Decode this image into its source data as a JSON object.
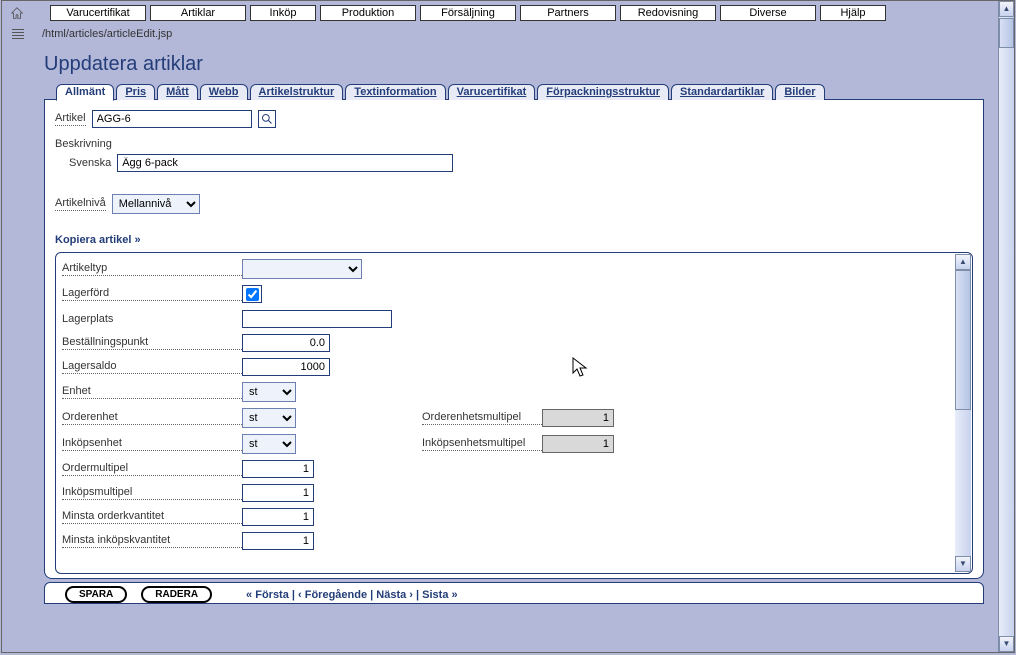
{
  "topmenu": [
    "Varucertifikat",
    "Artiklar",
    "Inköp",
    "Produktion",
    "Försäljning",
    "Partners",
    "Redovisning",
    "Diverse",
    "Hjälp"
  ],
  "path": "/html/articles/articleEdit.jsp",
  "title": "Uppdatera artiklar",
  "tabs": [
    "Allmänt",
    "Pris",
    "Mått",
    "Webb",
    "Artikelstruktur",
    "Textinformation",
    "Varucertifikat",
    "Förpackningsstruktur",
    "Standardartiklar",
    "Bilder"
  ],
  "active_tab": 0,
  "article": {
    "label": "Artikel",
    "value": "AGG-6"
  },
  "description": {
    "heading": "Beskrivning",
    "lang_label": "Svenska",
    "value": "Ägg 6-pack"
  },
  "level": {
    "label": "Artikelnivå",
    "value": "Mellannivå"
  },
  "copy_link": "Kopiera artikel »",
  "form": {
    "artikeltyp": {
      "label": "Artikeltyp",
      "value": ""
    },
    "lagerford": {
      "label": "Lagerförd",
      "checked": true
    },
    "lagerplats": {
      "label": "Lagerplats",
      "value": ""
    },
    "bestallningspunkt": {
      "label": "Beställningspunkt",
      "value": "0.0"
    },
    "lagersaldo": {
      "label": "Lagersaldo",
      "value": "1000"
    },
    "enhet": {
      "label": "Enhet",
      "value": "st"
    },
    "orderenhet": {
      "label": "Orderenhet",
      "value": "st"
    },
    "orderenhetsmultipel": {
      "label": "Orderenhetsmultipel",
      "value": "1"
    },
    "inkopsenhet": {
      "label": "Inköpsenhet",
      "value": "st"
    },
    "inkopsenhetsmultipel": {
      "label": "Inköpsenhetsmultipel",
      "value": "1"
    },
    "ordermultipel": {
      "label": "Ordermultipel",
      "value": "1"
    },
    "inkopsmultipel": {
      "label": "Inköpsmultipel",
      "value": "1"
    },
    "minsta_orderkvantitet": {
      "label": "Minsta orderkvantitet",
      "value": "1"
    },
    "minsta_inkopskvantitet": {
      "label": "Minsta inköpskvantitet",
      "value": "1"
    }
  },
  "footer": {
    "save": "SPARA",
    "delete": "RADERA",
    "nav": "« Första | ‹ Föregående | Nästa › | Sista »"
  }
}
